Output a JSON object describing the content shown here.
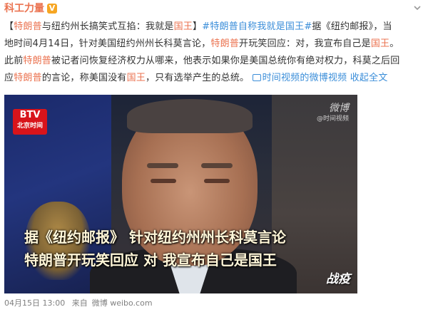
{
  "author": {
    "name": "科工力量",
    "verified_badge": "V"
  },
  "post": {
    "line1": {
      "p1": "【",
      "p2": "特朗普",
      "p3": "与纽约州长搞笑式互掐：我就是",
      "p4": "国王",
      "p5": "】",
      "p6": "#特朗普自称我就是国王#",
      "p7": "据《纽约邮报》，当"
    },
    "line2": {
      "p1": "地时间4月14日，针对美国纽约州州长科莫言论，",
      "p2": "特朗普",
      "p3": "开玩笑回应：对，我宣布自己是",
      "p4": "国王",
      "p5": "。"
    },
    "line3": {
      "p1": "此前",
      "p2": "特朗普",
      "p3": "被记者问恢复经济权力从哪来，他表示如果你是美国总统你有绝对权力，科莫之后回"
    },
    "line4": {
      "p1": "应",
      "p2": "特朗普",
      "p3": "的言论，称美国没有",
      "p4": "国王",
      "p5": "，只有选举产生的总统。",
      "video_link": "时间视频的微博视频",
      "collapse": "收起全文"
    }
  },
  "video": {
    "logo_top": "BTV",
    "logo_bottom": "北京时间",
    "watermark_top": "微博",
    "watermark_bottom": "@时间视频",
    "subtitle_line1": "据《纽约邮报》 针对纽约州州长科莫言论",
    "subtitle_line2": "特朗普开玩笑回应 对 我宣布自己是国王",
    "corner_brand": "战疫"
  },
  "footer": {
    "date": "04月15日 13:00",
    "source_prefix": "来自",
    "source": "微博 weibo.com"
  },
  "colors": {
    "link": "#eb7350",
    "topic": "#3b8ed9",
    "meta": "#808080"
  }
}
